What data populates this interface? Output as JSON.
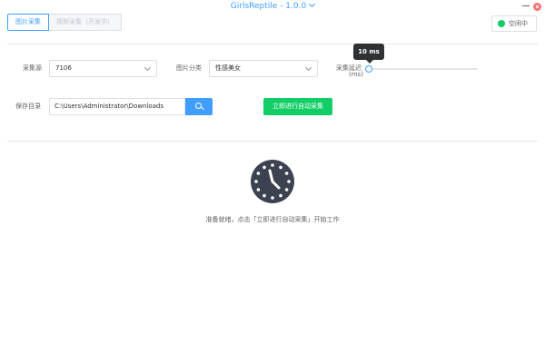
{
  "app": {
    "title": "GirlsReptile - 1.0.0"
  },
  "tabs": [
    {
      "label": "图片采集",
      "active": true
    },
    {
      "label": "视频采集（开发中）",
      "disabled": true
    }
  ],
  "status": {
    "label": "空闲中",
    "color": "#13ce66"
  },
  "form": {
    "source": {
      "label": "采集源",
      "value": "7106"
    },
    "category": {
      "label": "图片分类",
      "value": "性感美女"
    },
    "delay": {
      "label": "采集延迟",
      "label_unit": "(ms)",
      "value": 10,
      "tooltip": "10 ms"
    },
    "save_dir": {
      "label": "保存目录",
      "value": "C:\\Users\\Administrator\\Downloads"
    }
  },
  "actions": {
    "start_label": "立即进行自动采集"
  },
  "message": "准备就绪，点击「立即进行自动采集」开始工作",
  "icons": {
    "title_dropdown": "chevron-down-icon",
    "minimize": "minimize-icon",
    "close": "close-icon",
    "search": "search-icon",
    "status": "status-dot-icon",
    "empty_state": "clock-icon"
  },
  "colors": {
    "primary": "#409EFF",
    "success": "#13ce66",
    "danger": "#f56c6c",
    "clock": "#3c4250"
  }
}
